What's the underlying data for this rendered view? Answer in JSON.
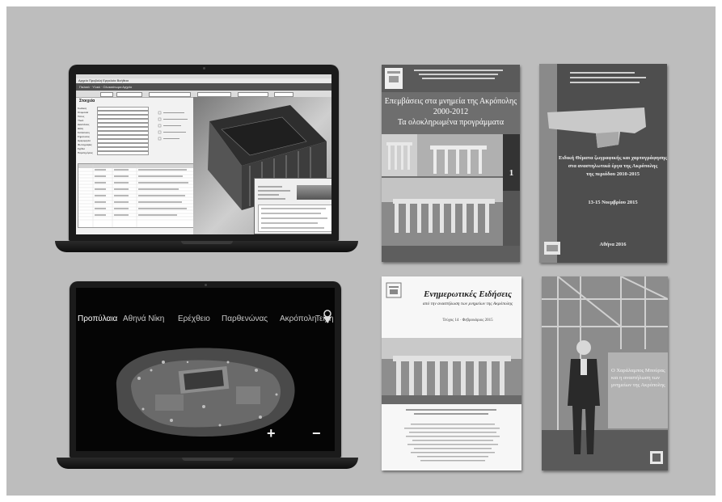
{
  "laptop_app": {
    "menu": "Αρχείο  Προβολή  Εργαλεία  Βοήθεια",
    "path": "Παλαιά  ·  Υλικό  ·  Ολοκαύτωμα Αρχείο",
    "panel_title": "Στοιχεία",
    "form_labels": [
      "Κωδικός",
      "Ονομασία",
      "Τύπος",
      "Υλικό",
      "Διαστάσεις",
      "Θέση",
      "Κατάσταση",
      "Σημειώσεις",
      "Ημερομηνία",
      "Φωτογραφίες",
      "Σχέδια",
      "Παρατηρήσεις"
    ]
  },
  "laptop_map": {
    "nav": [
      "Προπύλαια",
      "Αθηνά Νίκη",
      "Ερέχθειο",
      "Παρθενώνας",
      "Ακρόπολη",
      "Τείχη"
    ],
    "active_index": 0,
    "zoom_in": "+",
    "zoom_out": "−"
  },
  "covers": {
    "c1": {
      "title_lines": [
        "Επεμβάσεις στα μνημεία της Ακρόπολης",
        "2000-2012",
        "Τα ολοκληρωμένα προγράμματα"
      ],
      "volume": "1"
    },
    "c2": {
      "subtitle": "Ειδική Θέματα ζωγραφικής και χαρτογράφησης\nστα αναστηλωτικά έργα της Ακρόπολης\nτης περιόδου 2010-2015",
      "date": "13-15 Νοεμβρίου 2015",
      "city": "Αθήνα 2016"
    },
    "c3": {
      "title": "Ενημερωτικές Ειδήσεις",
      "subtitle": "από την αναστήλωση των μνημείων της Ακρόπολης",
      "issue": "Τεύχος 14 · Φεβρουάριος 2015"
    },
    "c4": {
      "title": "Ο Χαράλαμπος Μπούρας\nκαι η αναστήλωση των\nμνημείων της Ακρόπολης"
    }
  }
}
